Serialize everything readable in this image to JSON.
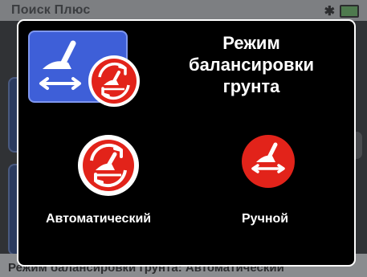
{
  "background": {
    "top_title": "Поиск Плюс",
    "bottom_text": "Режим балансировки грунта: Автоматический"
  },
  "dialog": {
    "title_lines": [
      "Режим",
      "балансировки",
      "грунта"
    ],
    "current_mode_icon": "detector-with-auto-balance-icon",
    "options": [
      {
        "label": "Автоматический",
        "icon": "auto-balance-icon",
        "color": "#e2231a"
      },
      {
        "label": "Ручной",
        "icon": "manual-balance-icon",
        "color": "#e2231a"
      }
    ]
  },
  "colors": {
    "accent_blue": "#3e5fd8",
    "icon_red": "#e2231a",
    "dialog_bg": "#000000"
  }
}
